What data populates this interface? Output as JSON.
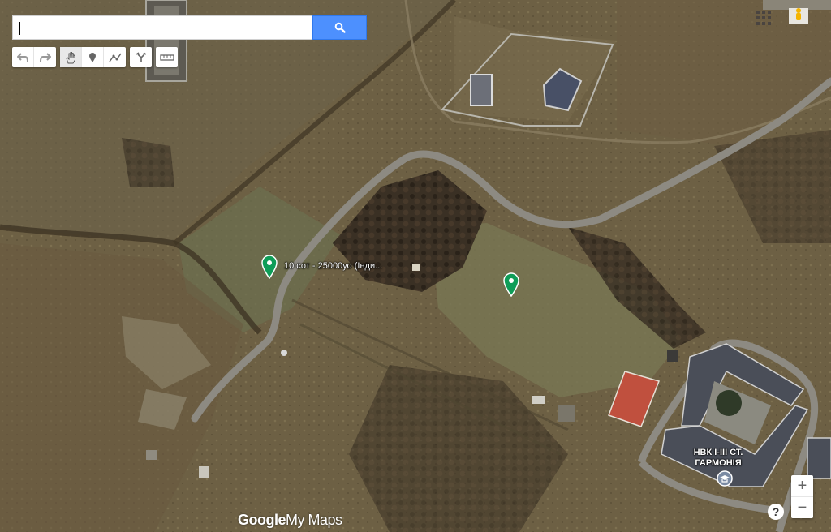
{
  "search": {
    "value": "",
    "placeholder": ""
  },
  "toolbar": {
    "undo": "undo-icon",
    "redo": "redo-icon",
    "pan": "hand-icon",
    "marker": "marker-icon",
    "line": "line-icon",
    "directions": "directions-icon",
    "measure": "ruler-icon"
  },
  "markers": [
    {
      "label": "10 сот - 25000уо (Інди...",
      "color": "#0f9d58"
    },
    {
      "label": "",
      "color": "#0f9d58"
    }
  ],
  "poi": {
    "line1": "НВК І-ІІІ СТ.",
    "line2": "ГАРМОНІЯ"
  },
  "logo": {
    "google": "Google",
    "mymaps": "My Maps"
  },
  "zoom": {
    "in": "+",
    "out": "−"
  },
  "help": "?"
}
